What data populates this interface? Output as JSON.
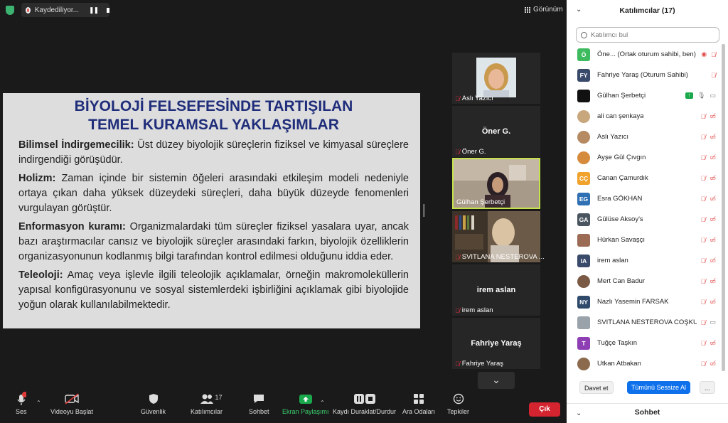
{
  "topbar": {
    "recording_label": "Kaydediliyor...",
    "view_label": "Görünüm"
  },
  "slide": {
    "title_line1": "BİYOLOJİ FELSEFESİNDE TARTIŞILAN",
    "title_line2": "TEMEL KURAMSAL YAKLAŞIMLAR",
    "paragraphs": [
      {
        "term": "Bilimsel İndirgemecilik:",
        "text": " Üst düzey biyolojik süreçlerin fiziksel ve kimyasal süreçlere indirgendiği görüşüdür."
      },
      {
        "term": "Holizm:",
        "text": " Zaman içinde bir sistemin öğeleri arasındaki etkileşim modeli nedeniyle ortaya çıkan daha yüksek düzeydeki süreçleri, daha büyük düzeyde fenomenleri vurgulayan görüştür."
      },
      {
        "term": "Enformasyon kuramı:",
        "text": " Organizmalardaki tüm süreçler fiziksel yasalara uyar, ancak bazı araştırmacılar cansız ve biyolojik süreçler arasındaki farkın, biyolojik özelliklerin organizasyonunun kodlanmış bilgi tarafından kontrol edilmesi olduğunu iddia eder."
      },
      {
        "term": "Teleoloji:",
        "text": " Amaç veya işlevle ilgili teleolojik açıklamalar, örneğin makromoleküllerin yapısal konfigürasyonunu ve sosyal sistemlerdeki işbirliğini açıklamak gibi biyolojide yoğun olarak kullanılabilmektedir."
      }
    ]
  },
  "tiles": [
    {
      "name": "Aslı Yazıcı",
      "center": ""
    },
    {
      "name": "Öner G.",
      "center": "Öner G."
    },
    {
      "name": "Gülhan Şerbetçi",
      "center": ""
    },
    {
      "name": "SVITLANA NESTEROVA ...",
      "center": ""
    },
    {
      "name": "irem aslan",
      "center": "irem aslan"
    },
    {
      "name": "Fahriye Yaraş",
      "center": "Fahriye Yaraş"
    }
  ],
  "toolbar": {
    "audio": "Ses",
    "video": "Videoyu Başlat",
    "security": "Güvenlik",
    "participants": "Katılımcılar",
    "participants_count": "17",
    "chat": "Sohbet",
    "share": "Ekran Paylaşımı",
    "recording": "Kaydı Duraklat/Durdur",
    "breakout": "Ara Odaları",
    "reactions": "Tepkiler",
    "leave": "Çık"
  },
  "panel": {
    "title": "Katılımcılar (17)",
    "search_placeholder": "Katılımcı bul",
    "participants": [
      {
        "initials": "Ö",
        "name": "Öne... (Ortak oturum sahibi, ben)",
        "color": "#3dbb5e"
      },
      {
        "initials": "FY",
        "name": "Fahriye Yaraş (Oturum Sahibi)",
        "color": "#3a4a6b"
      },
      {
        "initials": "",
        "name": "Gülhan Şerbetçi",
        "color": "#111111"
      },
      {
        "initials": "",
        "name": "ali can şenkaya",
        "color": "#c9a77c"
      },
      {
        "initials": "",
        "name": "Aslı Yazıcı",
        "color": "#b68a62"
      },
      {
        "initials": "",
        "name": "Ayşe Gül Çıvgın",
        "color": "#d68a3c"
      },
      {
        "initials": "CÇ",
        "name": "Canan Çamurdık",
        "color": "#f0a22a"
      },
      {
        "initials": "EG",
        "name": "Esra GÖKHAN",
        "color": "#2f6fb3"
      },
      {
        "initials": "GA",
        "name": "Gülüse Aksoy's",
        "color": "#4a5560"
      },
      {
        "initials": "",
        "name": "Hürkan Savaşçı",
        "color": "#9b6b55"
      },
      {
        "initials": "IA",
        "name": "irem aslan",
        "color": "#3a4a6b"
      },
      {
        "initials": "",
        "name": "Mert Can Badur",
        "color": "#7a5a45"
      },
      {
        "initials": "NY",
        "name": "Nazlı Yasemin FARSAK",
        "color": "#2f4a6b"
      },
      {
        "initials": "",
        "name": "SVITLANA NESTEROVA COŞKUN",
        "color": "#9aa3aa"
      },
      {
        "initials": "T",
        "name": "Tuğçe Taşkın",
        "color": "#8e3fb3"
      },
      {
        "initials": "",
        "name": "Utkan Atbakan",
        "color": "#8b6a4e"
      }
    ],
    "invite_label": "Davet et",
    "mute_all_label": "Tümünü Sessize Al",
    "more_label": "...",
    "chat_title": "Sohbet"
  }
}
